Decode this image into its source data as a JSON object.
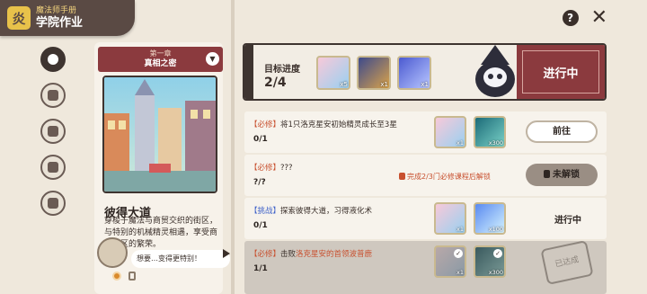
{
  "header": {
    "subtitle": "魔法师手册",
    "title": "学院作业",
    "logo_glyph": "炎"
  },
  "top_icons": {
    "help": "?",
    "close": "✕"
  },
  "chapter": {
    "number": "第一章",
    "name": "真相之密",
    "location_title": "彼得大道",
    "location_desc": "穿梭于魔法与商贸交织的街区，与特别的机械精灵相遇，享受商业街区的繁荣。",
    "bubble_text": "想要…变得更特别！"
  },
  "progress": {
    "label": "目标进度",
    "value": "2/4",
    "items": [
      {
        "count": "x5"
      },
      {
        "count": "x1"
      },
      {
        "count": "x1"
      }
    ],
    "status": "进行中"
  },
  "tasks": [
    {
      "tag": "【必修】",
      "text": "将1只洛克星安初始精灵成长至3星",
      "count": "0/1",
      "rewards": [
        {
          "count": "x1"
        },
        {
          "count": "x300"
        }
      ],
      "button": "前往"
    },
    {
      "tag": "【必修】",
      "text": "???",
      "count": "?/?",
      "lock_note": "完成2/3门必修课程后解锁",
      "button": "未解锁"
    },
    {
      "tag": "【挑战】",
      "text": "探索彼得大道，习得液化术",
      "count": "0/1",
      "rewards": [
        {
          "count": "x1"
        },
        {
          "count": "x100"
        }
      ],
      "status": "进行中"
    },
    {
      "tag": "【必修】",
      "text_pre": "击败",
      "text_hl": "洛克星安的首领波普鹿",
      "count": "1/1",
      "rewards": [
        {
          "count": "x1"
        },
        {
          "count": "x300"
        }
      ],
      "stamp": "已达成"
    }
  ],
  "colors": {
    "accent_red": "#8b3a3e",
    "dark": "#3e3430",
    "orange": "#c8502f",
    "blue": "#3f62c9"
  }
}
